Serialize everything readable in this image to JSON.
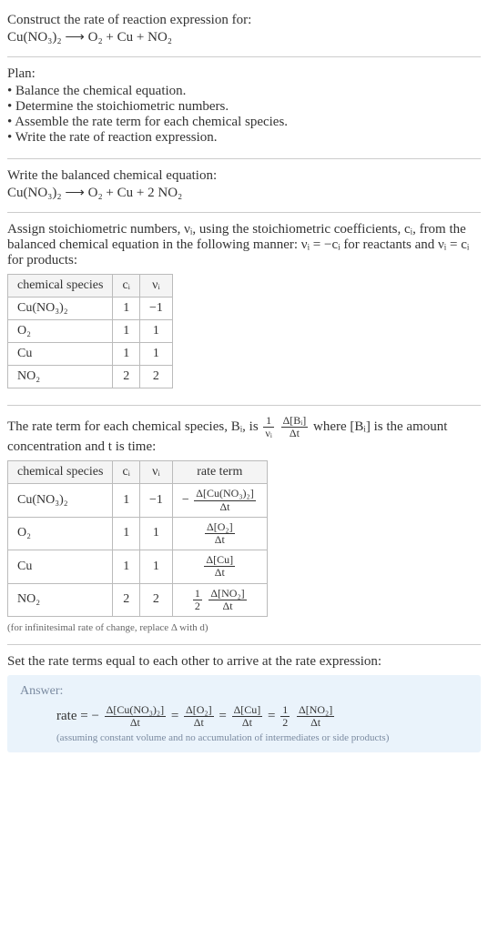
{
  "prompt": {
    "title": "Construct the rate of reaction expression for:",
    "equation": "Cu(NO₃)₂ ⟶ O₂ + Cu + NO₂"
  },
  "plan": {
    "title": "Plan:",
    "items": [
      "Balance the chemical equation.",
      "Determine the stoichiometric numbers.",
      "Assemble the rate term for each chemical species.",
      "Write the rate of reaction expression."
    ]
  },
  "balanced": {
    "title": "Write the balanced chemical equation:",
    "equation": "Cu(NO₃)₂ ⟶ O₂ + Cu + 2 NO₂"
  },
  "stoich": {
    "intro_a": "Assign stoichiometric numbers, νᵢ, using the stoichiometric coefficients, cᵢ, from the balanced chemical equation in the following manner: νᵢ = −cᵢ for reactants and νᵢ = cᵢ for products:",
    "headers": {
      "species": "chemical species",
      "ci": "cᵢ",
      "vi": "νᵢ"
    },
    "rows": [
      {
        "species": "Cu(NO₃)₂",
        "ci": "1",
        "vi": "−1"
      },
      {
        "species": "O₂",
        "ci": "1",
        "vi": "1"
      },
      {
        "species": "Cu",
        "ci": "1",
        "vi": "1"
      },
      {
        "species": "NO₂",
        "ci": "2",
        "vi": "2"
      }
    ]
  },
  "rateterm": {
    "intro_a": "The rate term for each chemical species, Bᵢ, is ",
    "intro_b": " where [Bᵢ] is the amount concentration and t is time:",
    "frac1": {
      "num": "1",
      "den": "νᵢ"
    },
    "frac2": {
      "num": "Δ[Bᵢ]",
      "den": "Δt"
    },
    "headers": {
      "species": "chemical species",
      "ci": "cᵢ",
      "vi": "νᵢ",
      "rate": "rate term"
    },
    "rows": [
      {
        "species": "Cu(NO₃)₂",
        "ci": "1",
        "vi": "−1",
        "prefix": "−",
        "num": "Δ[Cu(NO₃)₂]",
        "den": "Δt"
      },
      {
        "species": "O₂",
        "ci": "1",
        "vi": "1",
        "prefix": "",
        "num": "Δ[O₂]",
        "den": "Δt"
      },
      {
        "species": "Cu",
        "ci": "1",
        "vi": "1",
        "prefix": "",
        "num": "Δ[Cu]",
        "den": "Δt"
      },
      {
        "species": "NO₂",
        "ci": "2",
        "vi": "2",
        "prefix": "½",
        "num": "Δ[NO₂]",
        "den": "Δt",
        "half_num": "1",
        "half_den": "2"
      }
    ],
    "note": "(for infinitesimal rate of change, replace Δ with d)"
  },
  "final": {
    "title": "Set the rate terms equal to each other to arrive at the rate expression:"
  },
  "answer": {
    "label": "Answer:",
    "lead": "rate = −",
    "terms": [
      {
        "num": "Δ[Cu(NO₃)₂]",
        "den": "Δt"
      },
      {
        "num": "Δ[O₂]",
        "den": "Δt"
      },
      {
        "num": "Δ[Cu]",
        "den": "Δt"
      }
    ],
    "half": {
      "num": "1",
      "den": "2"
    },
    "lastterm": {
      "num": "Δ[NO₂]",
      "den": "Δt"
    },
    "eq": " = ",
    "assume": "(assuming constant volume and no accumulation of intermediates or side products)"
  },
  "chart_data": {
    "type": "table",
    "title": "Stoichiometric numbers and rate terms",
    "tables": [
      {
        "name": "stoichiometric numbers",
        "columns": [
          "chemical species",
          "cᵢ",
          "νᵢ"
        ],
        "rows": [
          [
            "Cu(NO₃)₂",
            1,
            -1
          ],
          [
            "O₂",
            1,
            1
          ],
          [
            "Cu",
            1,
            1
          ],
          [
            "NO₂",
            2,
            2
          ]
        ]
      },
      {
        "name": "rate terms",
        "columns": [
          "chemical species",
          "cᵢ",
          "νᵢ",
          "rate term"
        ],
        "rows": [
          [
            "Cu(NO₃)₂",
            1,
            -1,
            "−Δ[Cu(NO₃)₂]/Δt"
          ],
          [
            "O₂",
            1,
            1,
            "Δ[O₂]/Δt"
          ],
          [
            "Cu",
            1,
            1,
            "Δ[Cu]/Δt"
          ],
          [
            "NO₂",
            2,
            2,
            "(1/2) Δ[NO₂]/Δt"
          ]
        ]
      }
    ],
    "rate_expression": "rate = −Δ[Cu(NO₃)₂]/Δt = Δ[O₂]/Δt = Δ[Cu]/Δt = (1/2) Δ[NO₂]/Δt"
  }
}
